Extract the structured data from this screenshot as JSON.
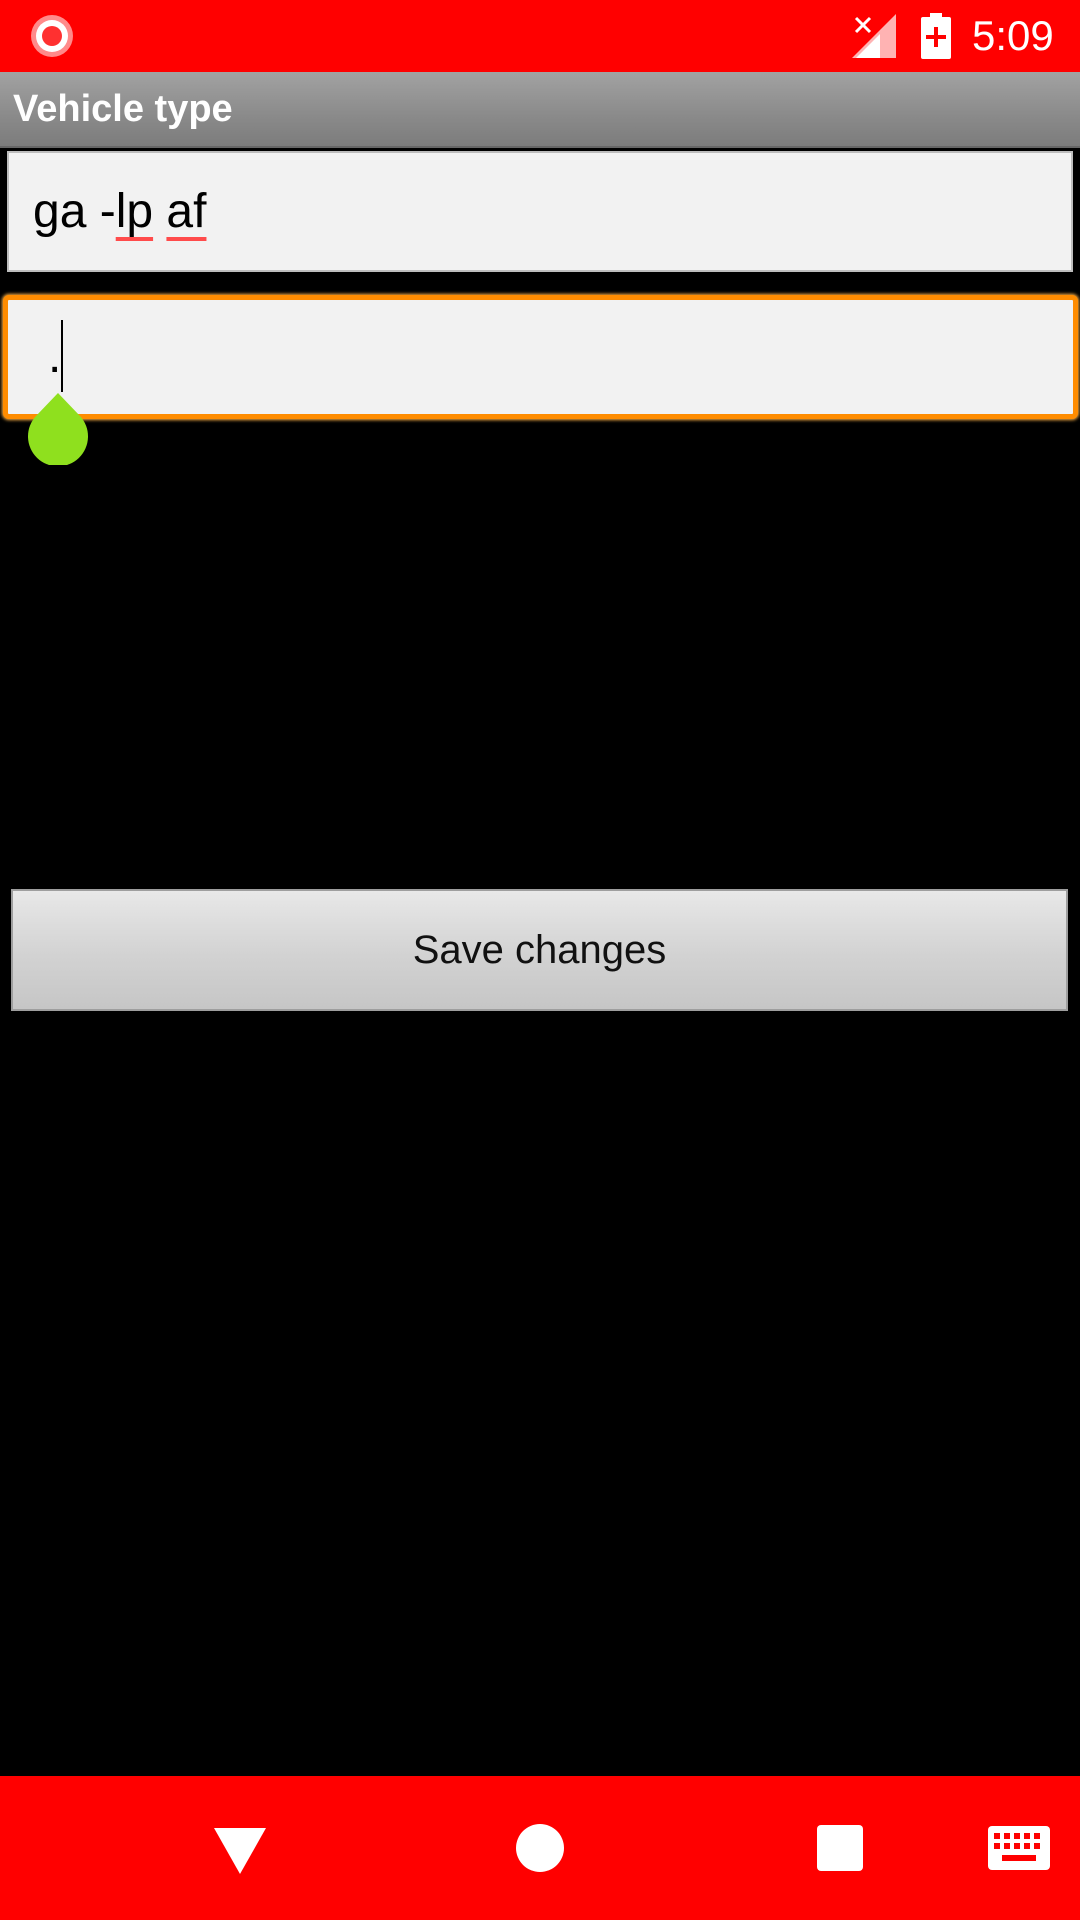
{
  "status_bar": {
    "time": "5:09",
    "icons": [
      "screen-record-icon",
      "signal-no-service-icon",
      "battery-charging-icon"
    ],
    "color": "#ff0000"
  },
  "title_bar": {
    "title": "Vehicle type"
  },
  "form": {
    "field_1_value": "ga -lp af",
    "field_1_misspelled": [
      "lp",
      "af"
    ],
    "field_2_value": ".",
    "field_2_focused": true,
    "focus_color": "#ff8c00",
    "handle_color": "#8fe01e"
  },
  "save_button": {
    "label": "Save changes"
  },
  "nav_bar": {
    "buttons": [
      "back-icon",
      "home-icon",
      "recents-icon",
      "keyboard-icon"
    ],
    "color": "#ff0000"
  }
}
